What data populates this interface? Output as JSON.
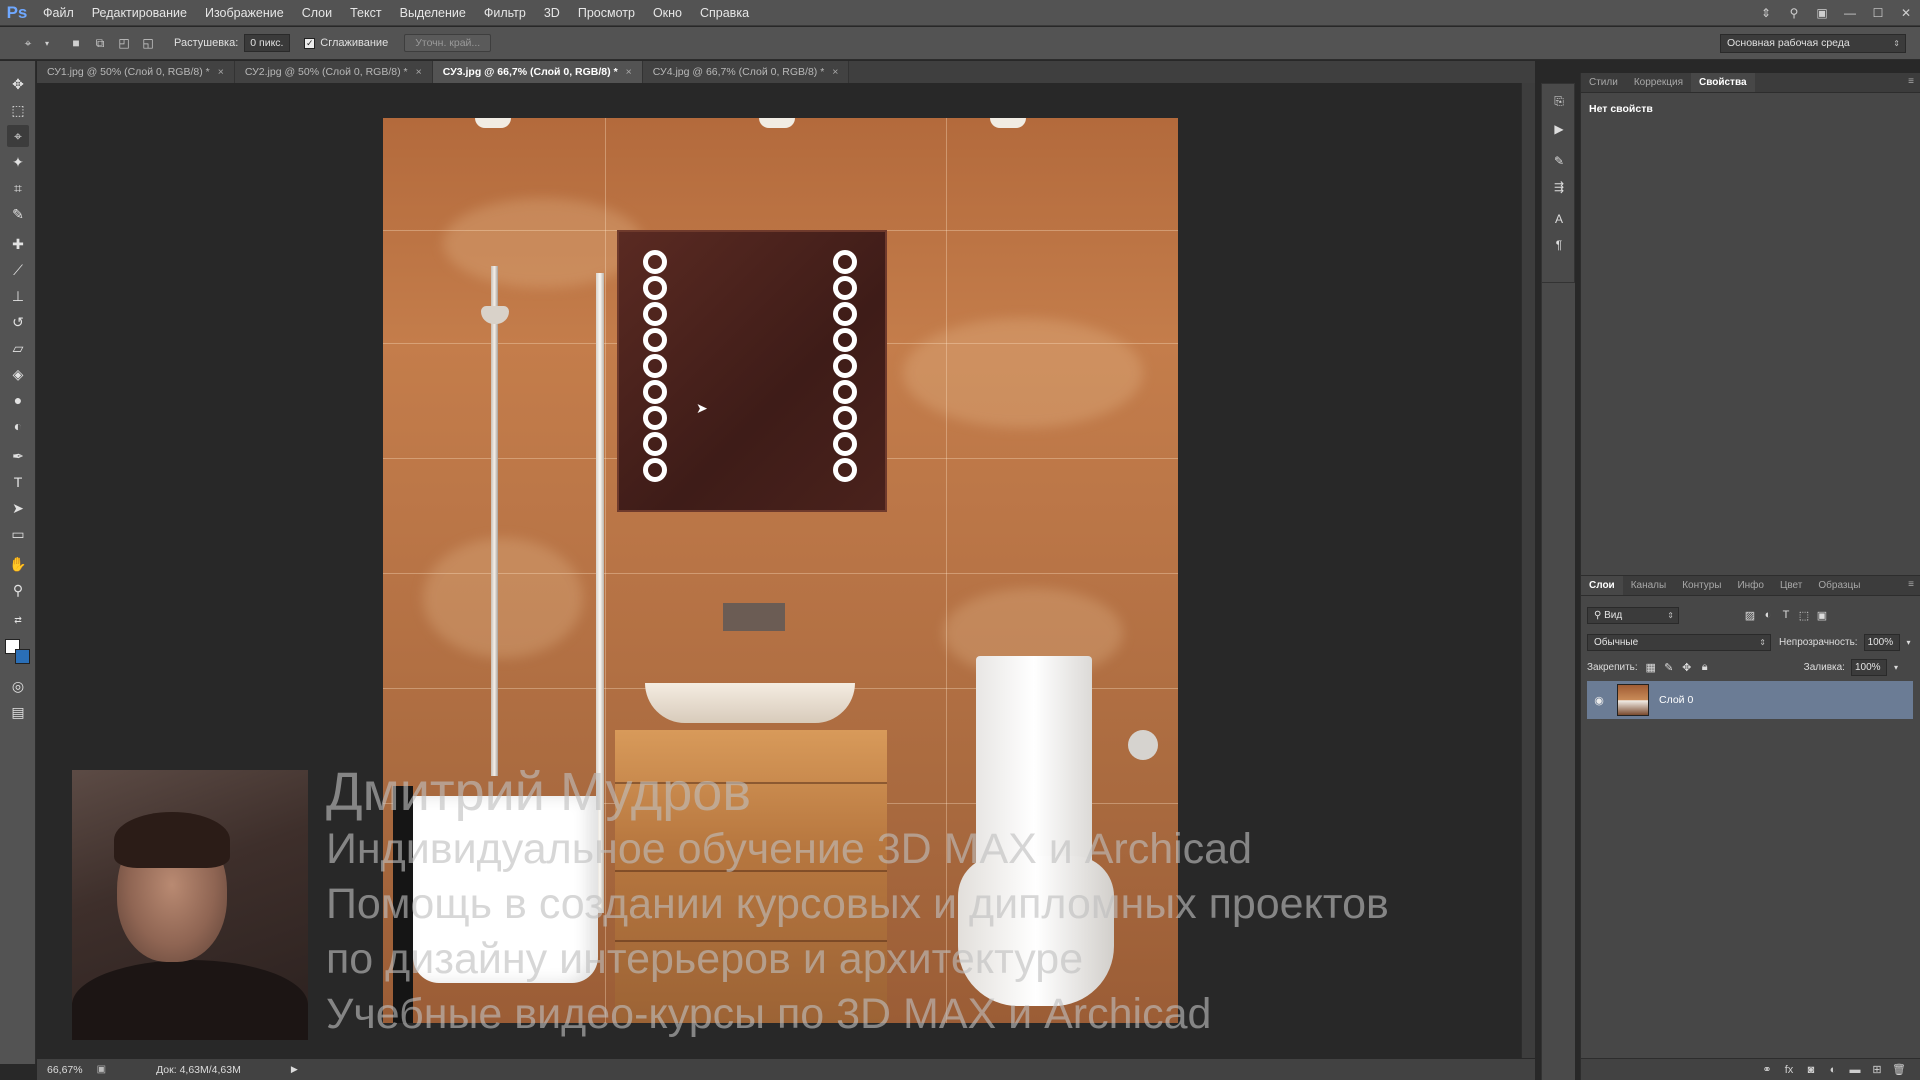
{
  "app": {
    "logo": "Ps"
  },
  "menu": [
    "Файл",
    "Редактирование",
    "Изображение",
    "Слои",
    "Текст",
    "Выделение",
    "Фильтр",
    "3D",
    "Просмотр",
    "Окно",
    "Справка"
  ],
  "options": {
    "feather_label": "Растушевка:",
    "feather_value": "0 пикс.",
    "antialias_label": "Сглаживание",
    "antialias_checked": true,
    "refine_edge_label": "Уточн. край...",
    "workspace": "Основная рабочая среда"
  },
  "tabs": [
    {
      "label": "СУ1.jpg @ 50% (Слой 0, RGB/8) *",
      "active": false
    },
    {
      "label": "СУ2.jpg @ 50% (Слой 0, RGB/8) *",
      "active": false
    },
    {
      "label": "СУ3.jpg @ 66,7% (Слой 0, RGB/8) *",
      "active": true
    },
    {
      "label": "СУ4.jpg @ 66,7% (Слой 0, RGB/8) *",
      "active": false
    }
  ],
  "status": {
    "zoom": "66,67%",
    "doc": "Док: 4,63M/4,63M"
  },
  "properties": {
    "tabs": [
      "Стили",
      "Коррекция",
      "Свойства"
    ],
    "active_tab": "Свойства",
    "empty_text": "Нет свойств"
  },
  "layers": {
    "tabs": [
      "Слои",
      "Каналы",
      "Контуры",
      "Инфо",
      "Цвет",
      "Образцы"
    ],
    "active_tab": "Слои",
    "filter_kind": "Вид",
    "blend_mode": "Обычные",
    "opacity_label": "Непрозрачность:",
    "opacity": "100%",
    "lock_label": "Закрепить:",
    "fill_label": "Заливка:",
    "fill": "100%",
    "items": [
      {
        "name": "Слой 0",
        "visible": true,
        "selected": true
      }
    ]
  },
  "overlay": {
    "name": "Дмитрий Мудров",
    "lines": [
      "Индивидуальное обучение 3D MAX и Archicad",
      "Помощь в создании курсовых и дипломных проектов",
      "по дизайну интерьеров и архитектуре",
      "Учебные видео-курсы по 3D MAX и Archicad"
    ]
  },
  "colors": {
    "foreground": "#ffffff",
    "background": "#2a6fb8",
    "selected_layer": "#6b7c95"
  },
  "icons": {
    "tools": [
      "move-icon",
      "marquee-icon",
      "polygonal-lasso-icon",
      "magic-wand-icon",
      "crop-icon",
      "eyedropper-icon",
      "healing-brush-icon",
      "brush-icon",
      "clone-stamp-icon",
      "history-brush-icon",
      "eraser-icon",
      "paint-bucket-icon",
      "blur-icon",
      "dodge-icon",
      "pen-icon",
      "type-icon",
      "path-selection-icon",
      "rectangle-icon",
      "hand-icon",
      "zoom-icon"
    ]
  }
}
